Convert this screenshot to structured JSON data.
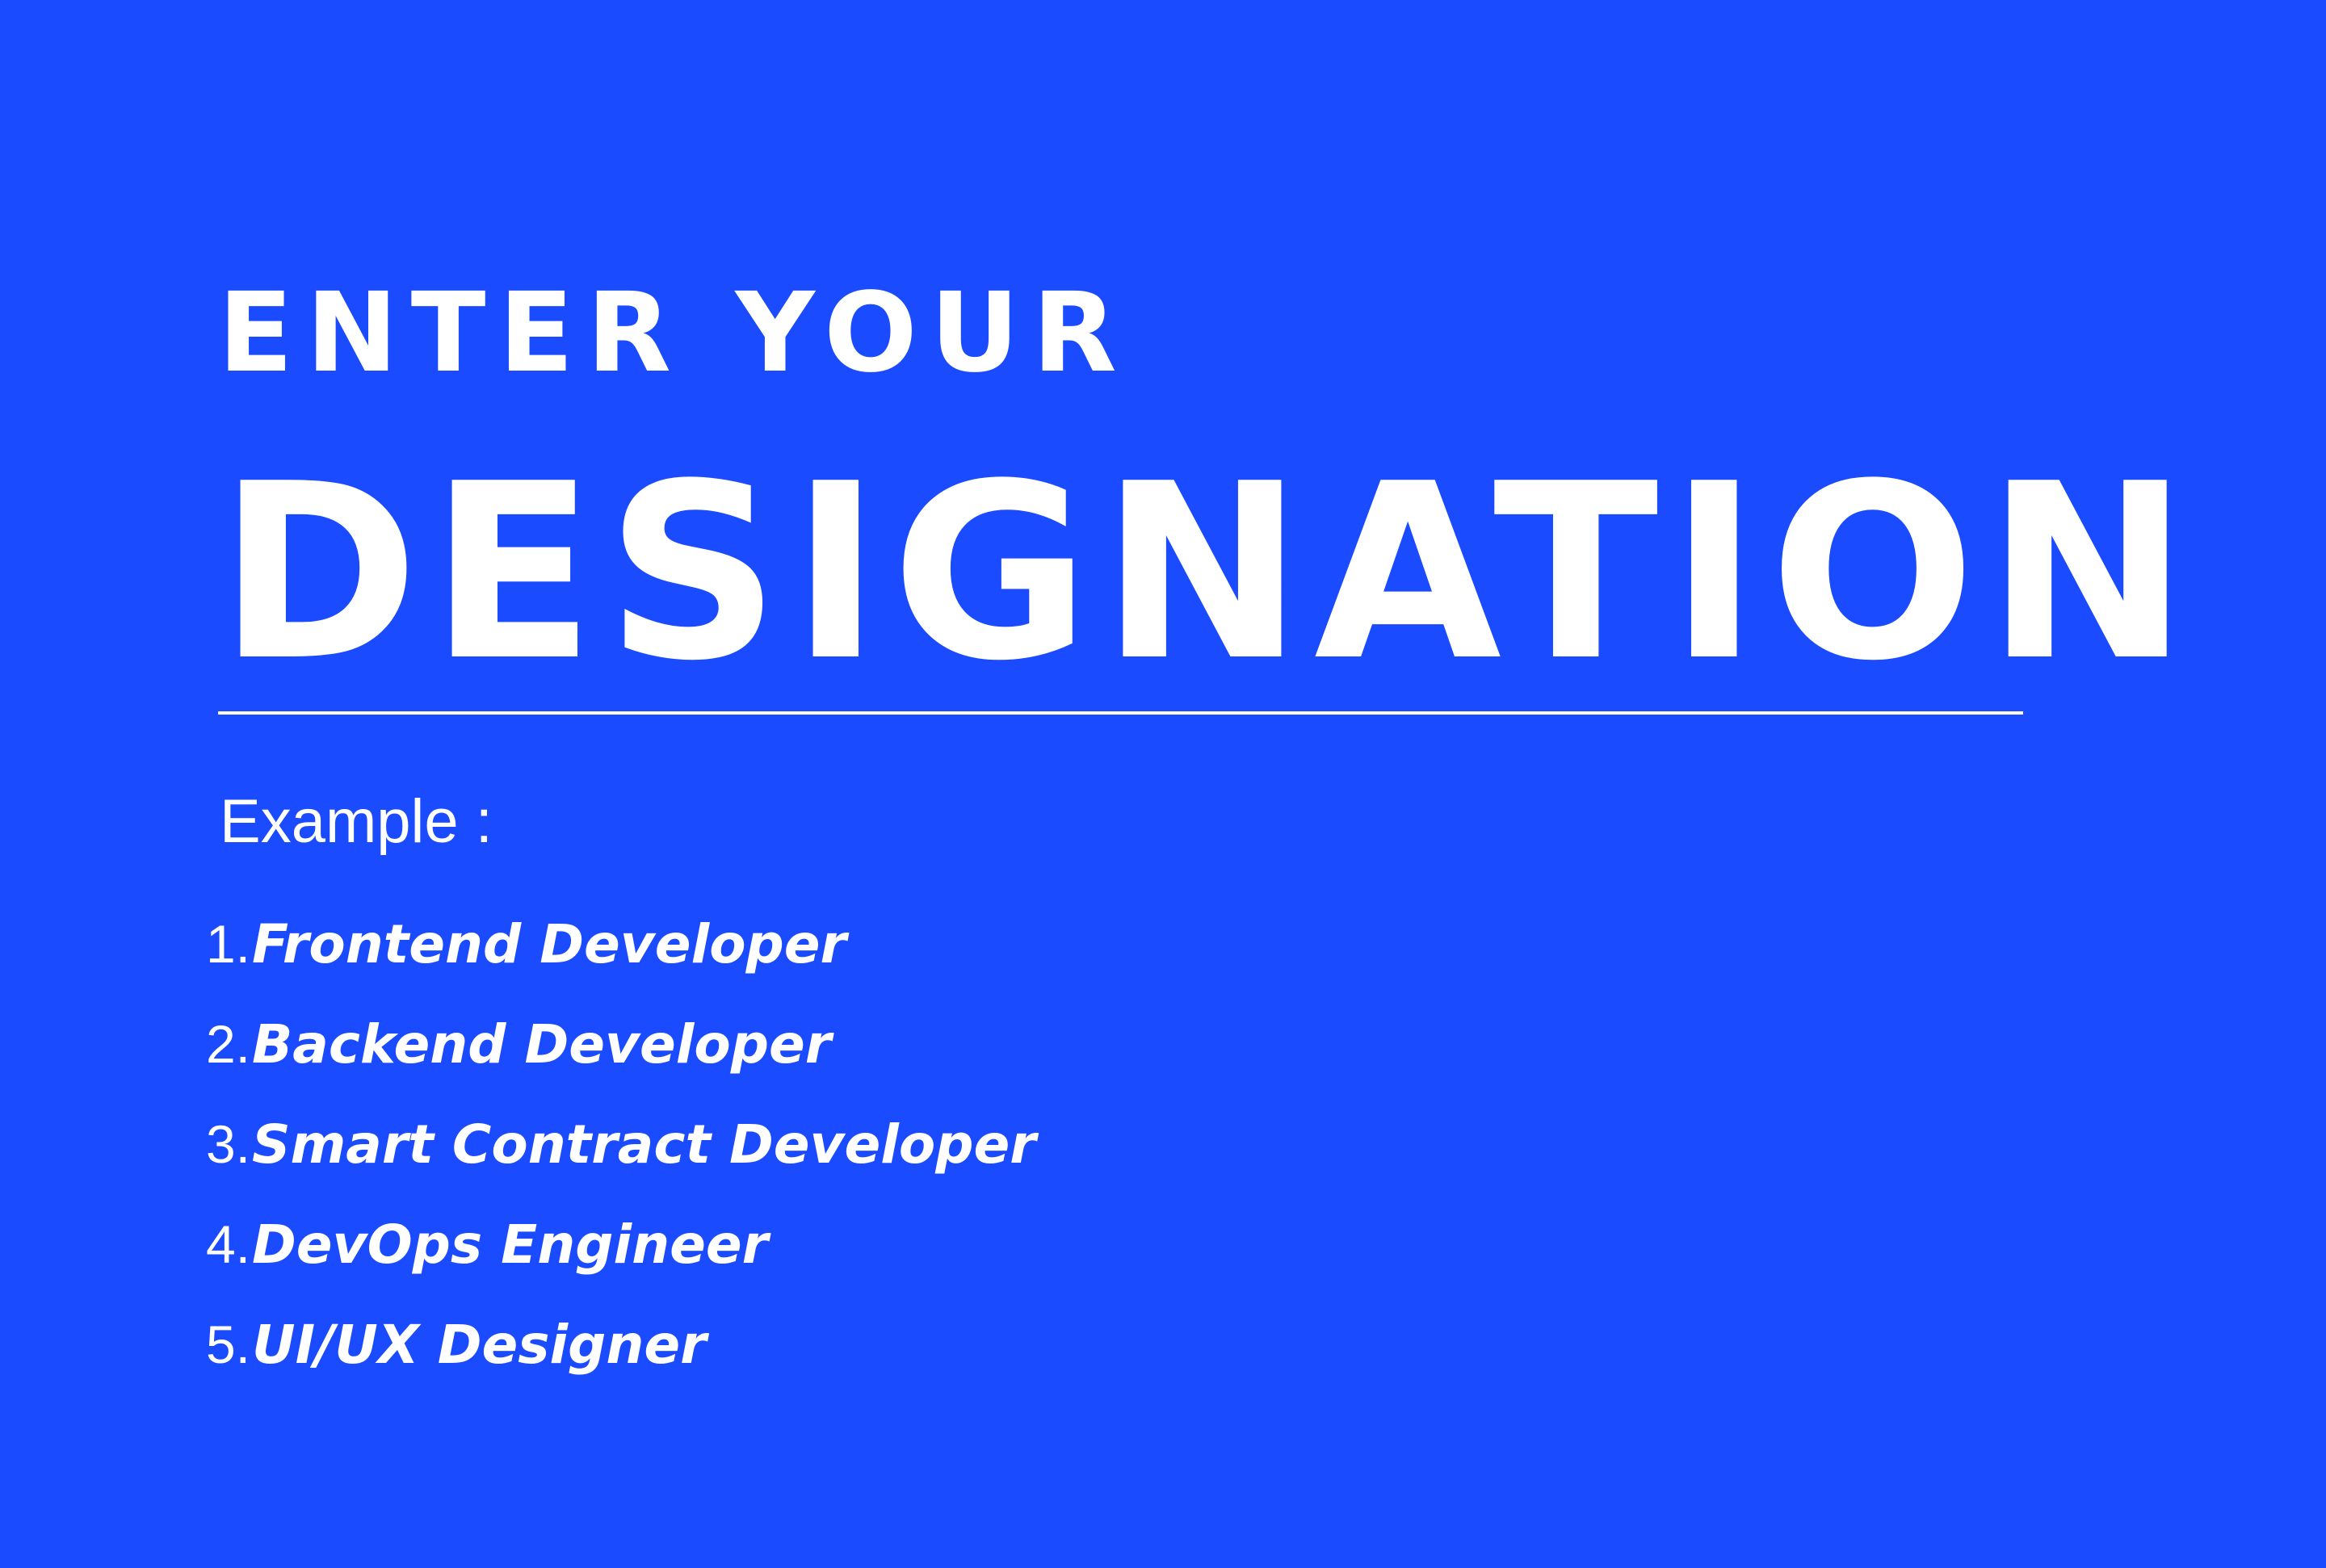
{
  "colors": {
    "background": "#1a4bff",
    "text": "#ffffff"
  },
  "heading": {
    "kicker": "ENTER YOUR",
    "title": "DESIGNATION"
  },
  "examples": {
    "label": "Example :",
    "items": [
      {
        "number": "1.",
        "text": "Frontend Developer"
      },
      {
        "number": "2.",
        "text": "Backend Developer"
      },
      {
        "number": "3.",
        "text": "Smart Contract Developer"
      },
      {
        "number": "4.",
        "text": "DevOps Engineer"
      },
      {
        "number": "5.",
        "text": "UI/UX Designer"
      }
    ]
  }
}
